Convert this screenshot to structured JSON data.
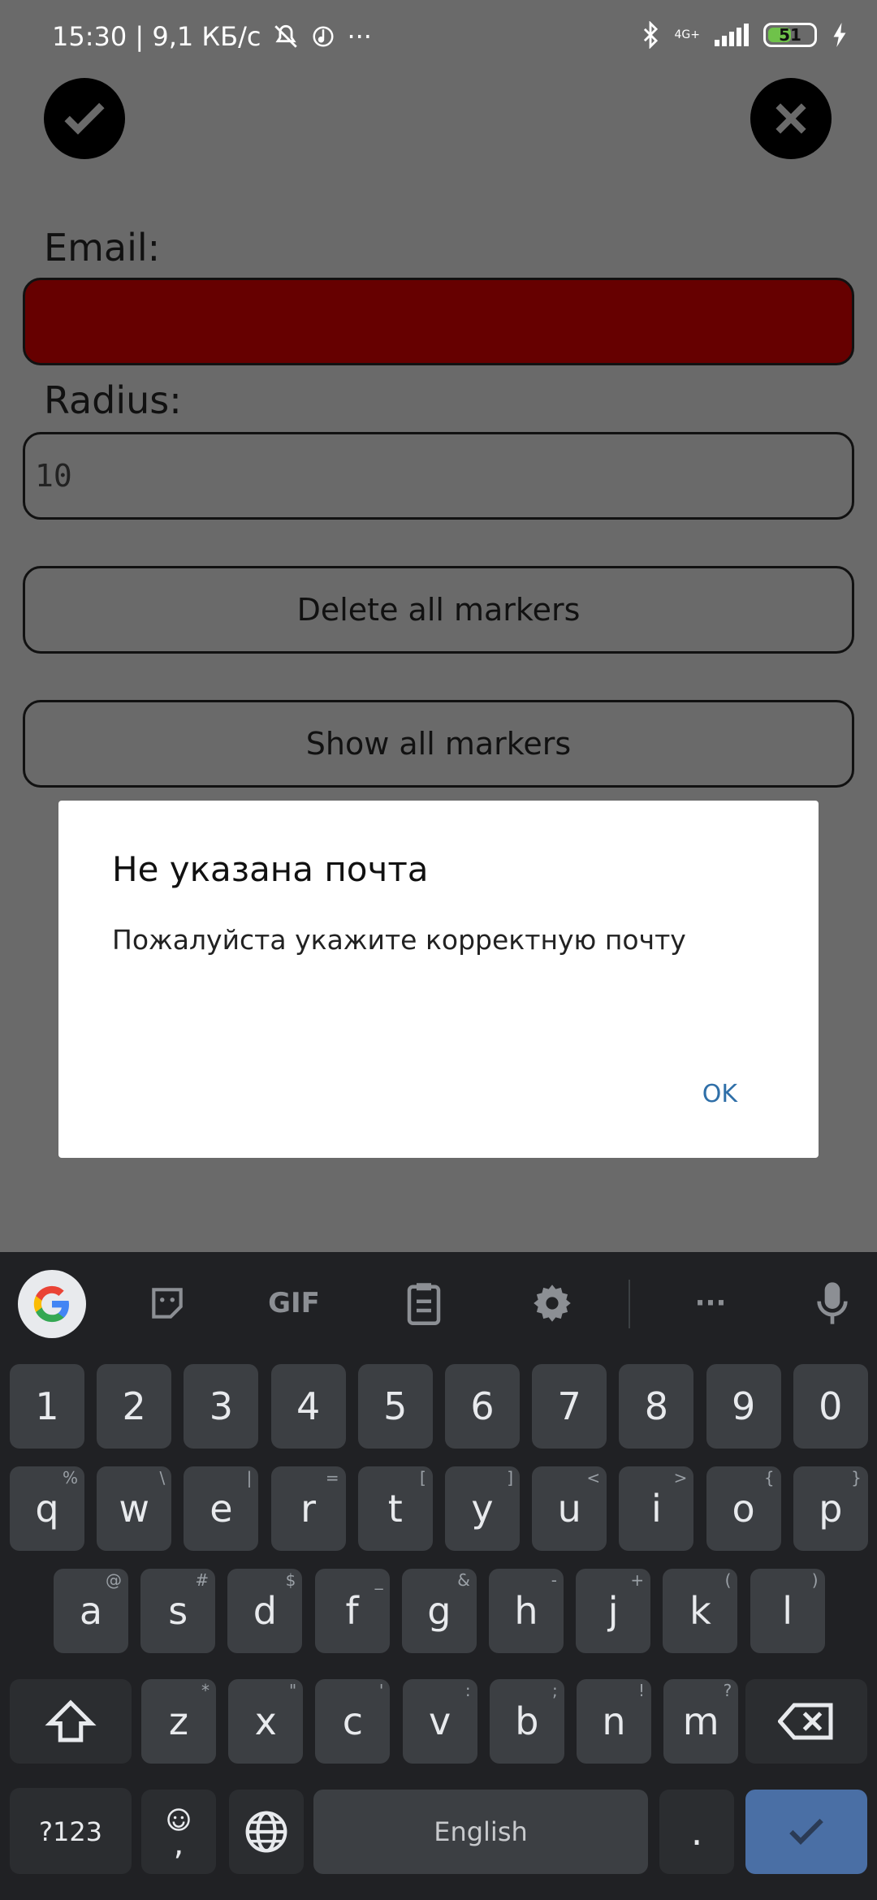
{
  "status_bar": {
    "time_speed": "15:30 | 9,1 КБ/с",
    "more": "···",
    "network": "4G+",
    "battery": "51",
    "battery_level": 0.51
  },
  "form": {
    "email_label": "Email:",
    "email_value": "",
    "radius_label": "Radius:",
    "radius_value": "10",
    "delete_button": "Delete all markers",
    "show_button": "Show all markers"
  },
  "dialog": {
    "title": "Не указана почта",
    "message": "Пожалуйста укажите корректную почту",
    "ok_label": "OK"
  },
  "keyboard": {
    "gif_label": "GIF",
    "more": "···",
    "number_row": [
      "1",
      "2",
      "3",
      "4",
      "5",
      "6",
      "7",
      "8",
      "9",
      "0"
    ],
    "row1": [
      "q",
      "w",
      "e",
      "r",
      "t",
      "y",
      "u",
      "i",
      "o",
      "p"
    ],
    "row1_hints": [
      "%",
      "\\",
      "|",
      "=",
      "[",
      "]",
      "<",
      ">",
      "{",
      "}"
    ],
    "row2": [
      "a",
      "s",
      "d",
      "f",
      "g",
      "h",
      "j",
      "k",
      "l"
    ],
    "row2_hints": [
      "@",
      "#",
      "$",
      "_",
      "&",
      "-",
      "+",
      "(",
      ")"
    ],
    "row3": [
      "z",
      "x",
      "c",
      "v",
      "b",
      "n",
      "m"
    ],
    "row3_hints": [
      "*",
      "\"",
      "'",
      ":",
      ";",
      "!",
      "?"
    ],
    "symbols_key": "?123",
    "comma": ",",
    "space_label": "English",
    "period": "."
  },
  "colors": {
    "email_error_fill": "#660000",
    "overlay": "#6a6a6a",
    "dialog_button": "#2f6fa8",
    "enter_key": "#4a6fa5"
  }
}
